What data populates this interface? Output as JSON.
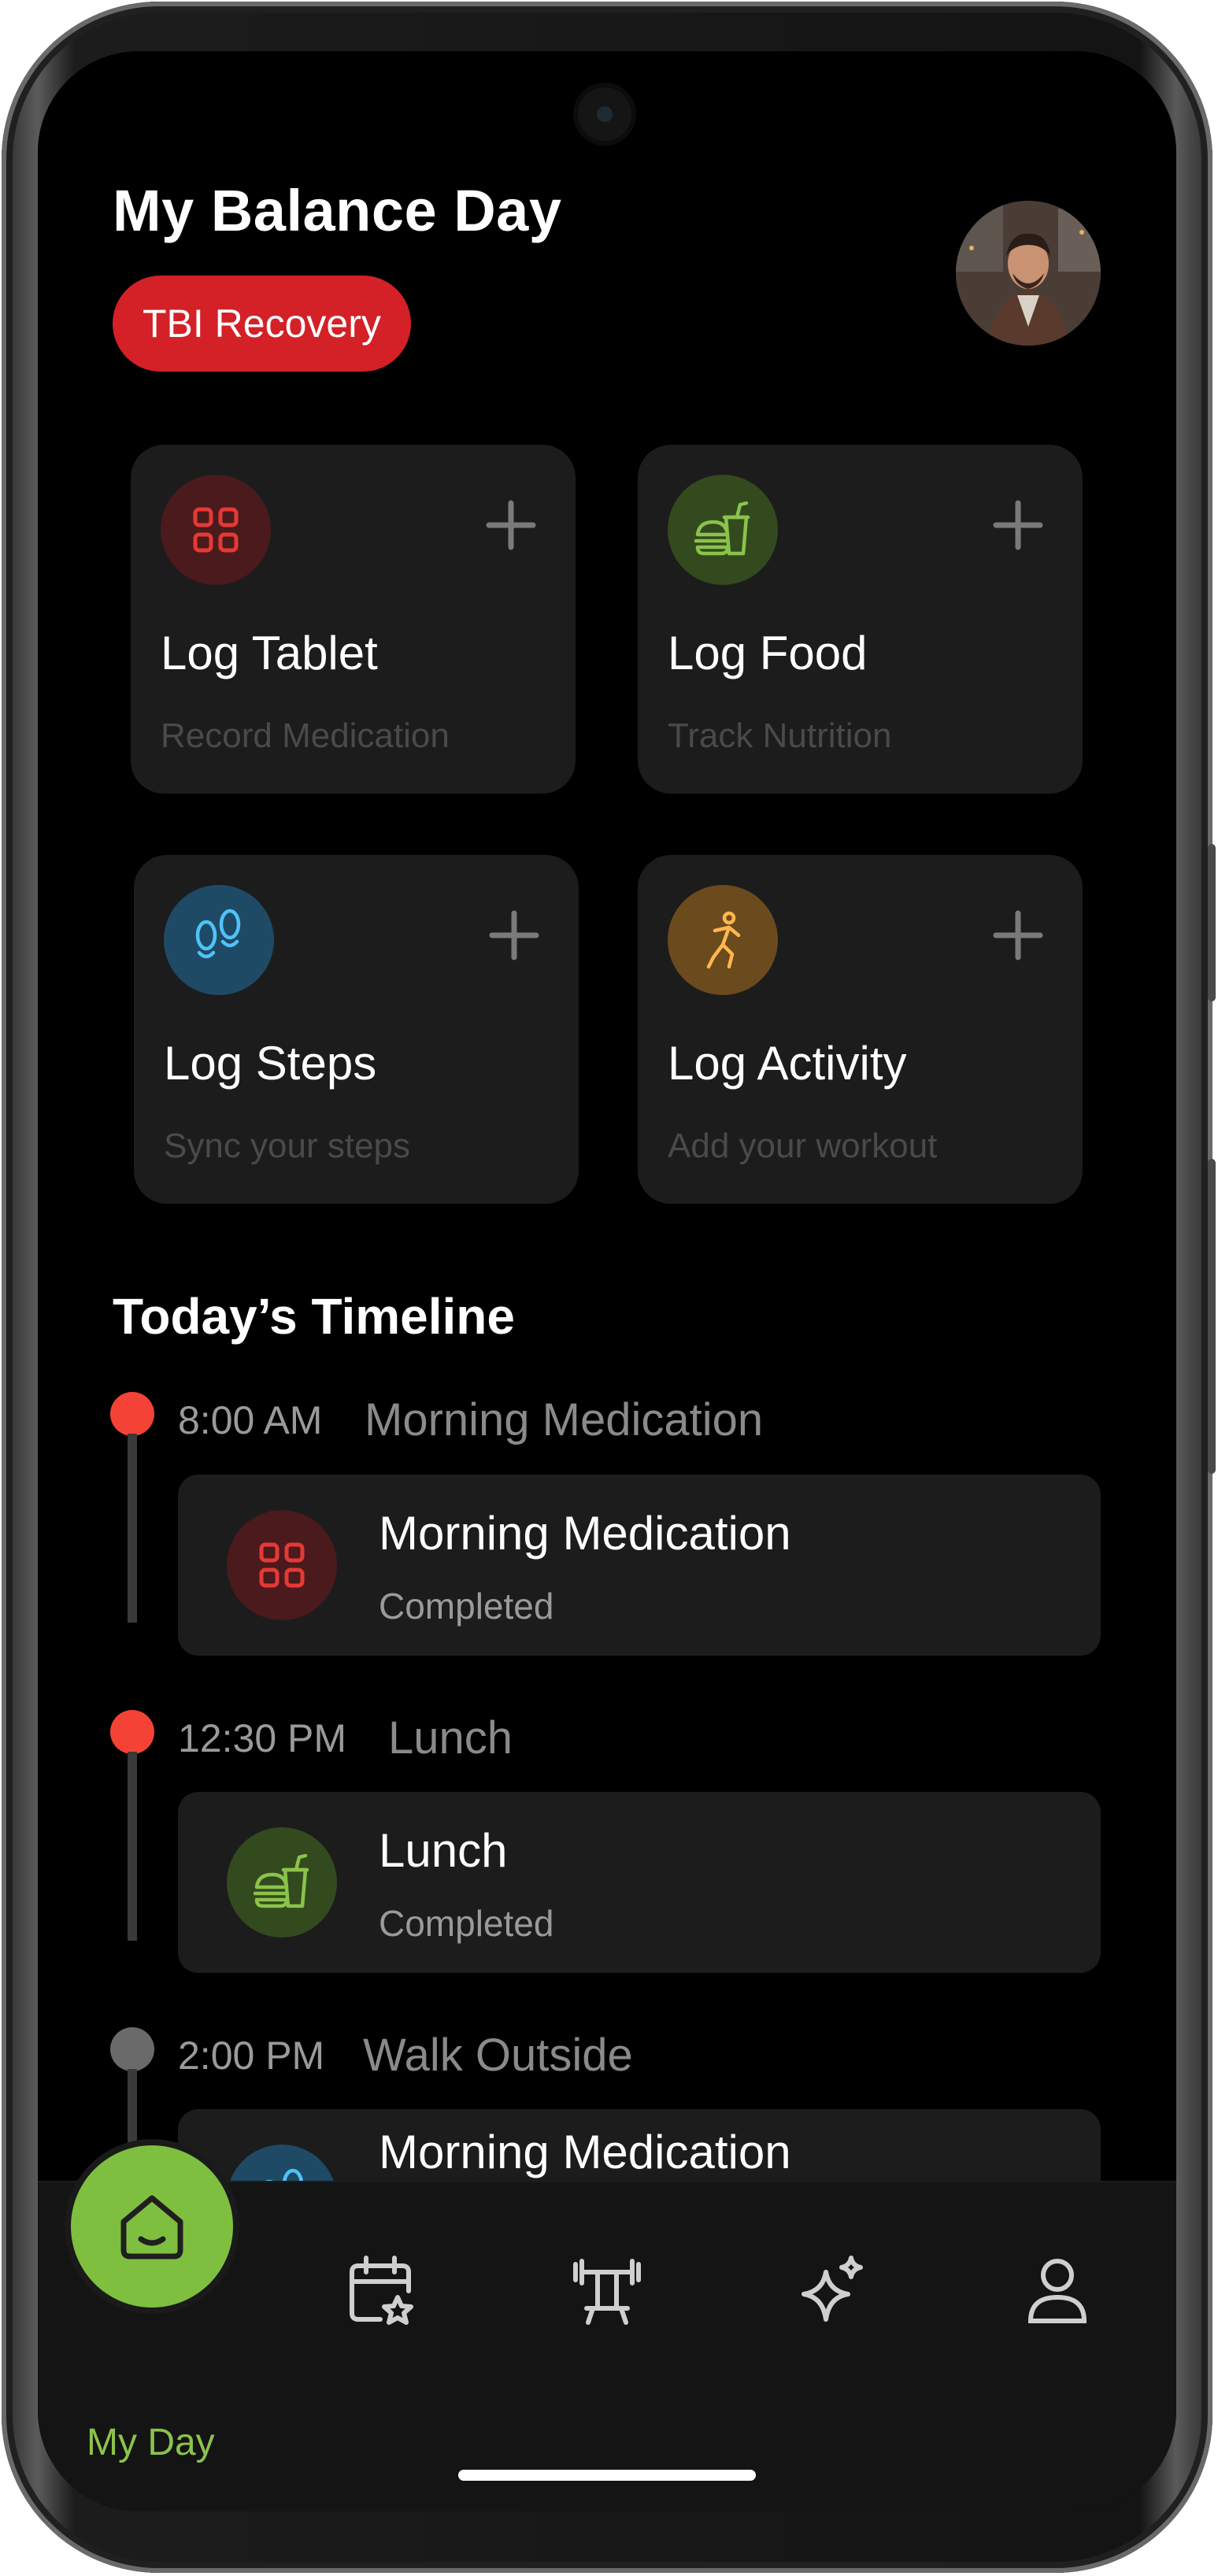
{
  "header": {
    "title": "My Balance Day",
    "badge": "TBI Recovery"
  },
  "quick_actions": [
    {
      "title": "Log Tablet",
      "subtitle": "Record Medication",
      "icon": "medication-grid-icon",
      "color": "#e53935"
    },
    {
      "title": "Log Food",
      "subtitle": "Track Nutrition",
      "icon": "food-burger-drink-icon",
      "color": "#8bc34a"
    },
    {
      "title": "Log Steps",
      "subtitle": "Sync your steps",
      "icon": "footsteps-icon",
      "color": "#4fc3f7"
    },
    {
      "title": "Log Activity",
      "subtitle": "Add your workout",
      "icon": "activity-person-icon",
      "color": "#ffb74d"
    }
  ],
  "timeline": {
    "title": "Today’s Timeline",
    "items": [
      {
        "time": "8:00 AM",
        "label": "Morning Medication",
        "card_title": "Morning Medication",
        "status": "Completed",
        "icon": "medication-grid-icon",
        "dot_color": "#f44336"
      },
      {
        "time": "12:30 PM",
        "label": "Lunch",
        "card_title": "Lunch",
        "status": "Completed",
        "icon": "food-burger-drink-icon",
        "dot_color": "#f44336"
      },
      {
        "time": "2:00 PM",
        "label": "Walk Outside",
        "card_title": "Morning Medication",
        "status": "",
        "icon": "footsteps-icon",
        "dot_color": "#6a6a6a"
      }
    ]
  },
  "nav": {
    "active_label": "My Day",
    "items": [
      "home-icon",
      "calendar-star-icon",
      "workout-bench-icon",
      "sparkle-icon",
      "profile-icon"
    ]
  },
  "colors": {
    "accent_green": "#8bc34a",
    "badge_red": "#d42027"
  }
}
